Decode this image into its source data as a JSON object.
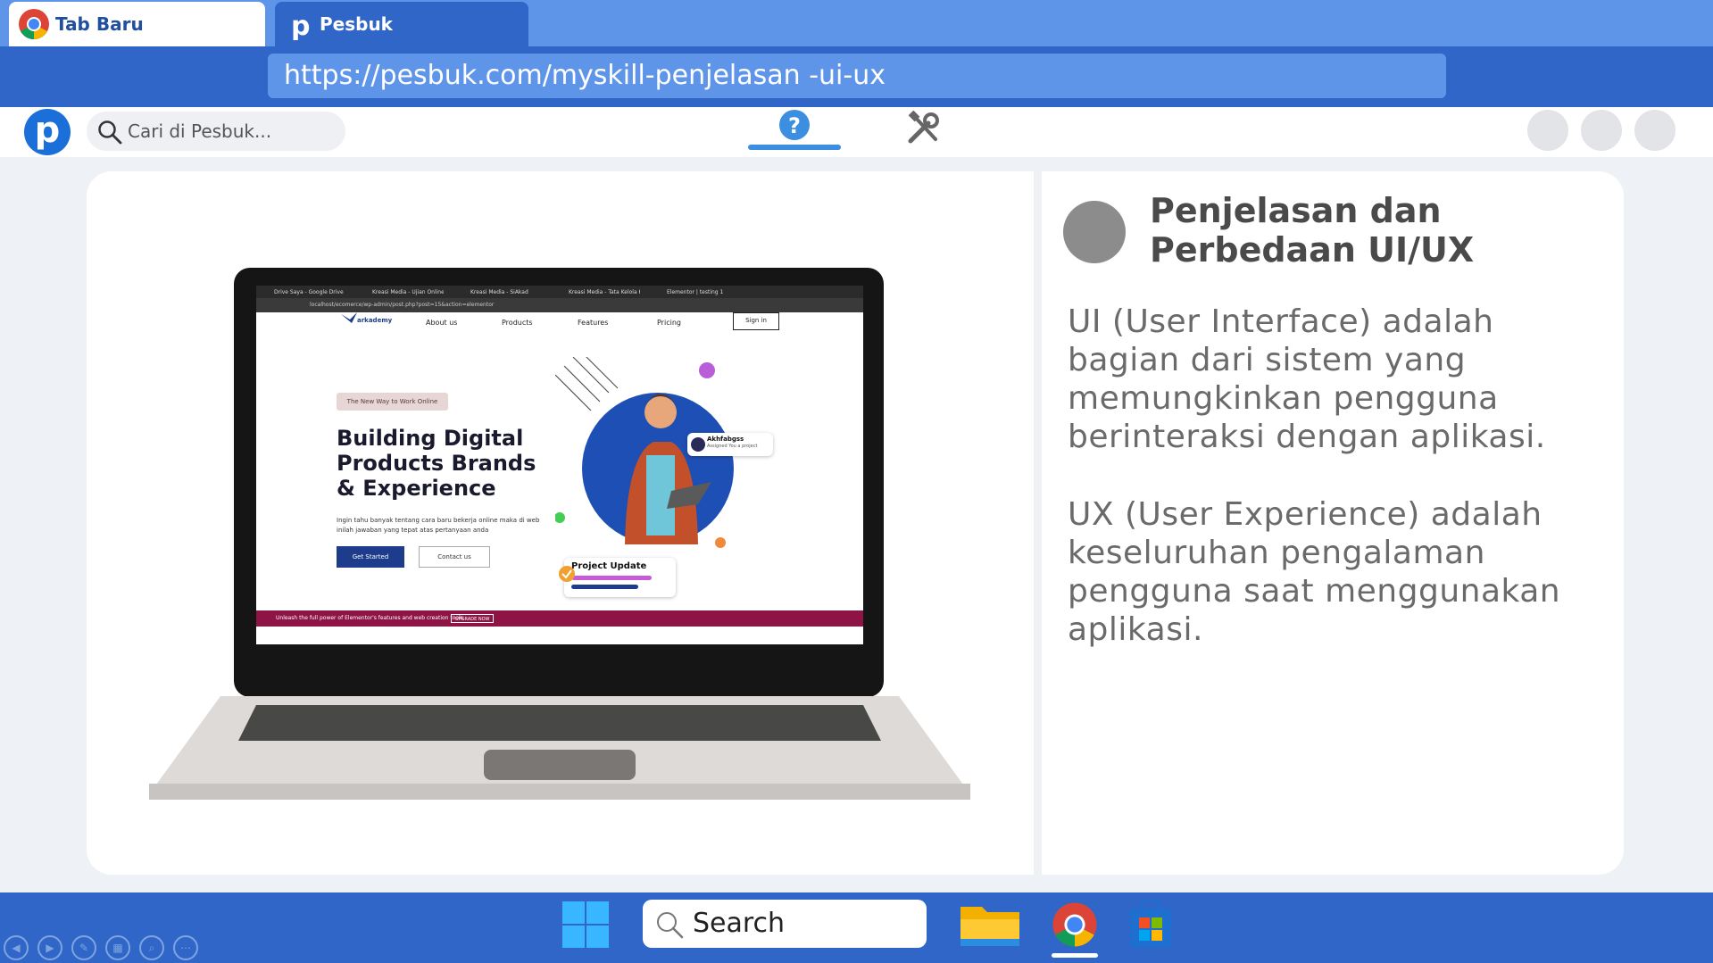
{
  "browser": {
    "tabs": [
      {
        "label": "Tab Baru",
        "active": true,
        "icon": "chrome-icon"
      },
      {
        "label": "Pesbuk",
        "active": false,
        "icon": "pesbuk-p-icon"
      }
    ],
    "url": "https://pesbuk.com/myskill-penjelasan -ui-ux"
  },
  "app_header": {
    "logo_letter": "p",
    "search_placeholder": "Cari di Pesbuk...",
    "nav_icons": [
      "help-question-icon",
      "tools-icon"
    ],
    "active_nav": "help-question-icon"
  },
  "article": {
    "title": "Penjelasan dan Perbedaan UI/UX",
    "paragraphs": [
      "UI (User Interface) adalah bagian dari sistem yang memungkinkan pengguna berinteraksi dengan aplikasi.",
      "UX (User Experience) adalah keseluruhan pengalaman pengguna saat menggunakan aplikasi."
    ]
  },
  "laptop_screen": {
    "browser_tabs": [
      "Drive Saya - Google Drive",
      "Kreasi Media - Ujian Online",
      "Kreasi Media - SiAkad",
      "Kreasi Media - Tata Kelola K",
      "Elementor | testing 1"
    ],
    "url": "localhost/ecomerce/wp-admin/post.php?post=15&action=elementor",
    "site_logo": "arkademy",
    "nav": [
      "About us",
      "Products",
      "Features",
      "Pricing"
    ],
    "signin": "Sign in",
    "chip": "The New Way to Work Online",
    "headline": "Building Digital Products Brands & Experience",
    "subtext": "Ingin tahu banyak tentang cara baru bekerja online maka di web inilah jawaban yang tepat atas pertanyaan anda",
    "primary_button": "Get Started",
    "secondary_button": "Contact us",
    "user_card_name": "Akhfabgss",
    "user_card_desc": "Assigned You a project",
    "project_card": "Project Update",
    "banner_text": "Unleash the full power of Elementor's features and web creation tools.",
    "banner_button": "UPGRADE NOW"
  },
  "taskbar": {
    "search_label": "Search",
    "apps": [
      "windows-start-icon",
      "file-explorer-icon",
      "chrome-icon",
      "microsoft-store-icon"
    ],
    "active_app": "chrome-icon"
  },
  "colors": {
    "tab_strip": "#5f95e8",
    "address_bar": "#2f66c8",
    "taskbar": "#2f66c8",
    "accent": "#3b8ee0"
  }
}
